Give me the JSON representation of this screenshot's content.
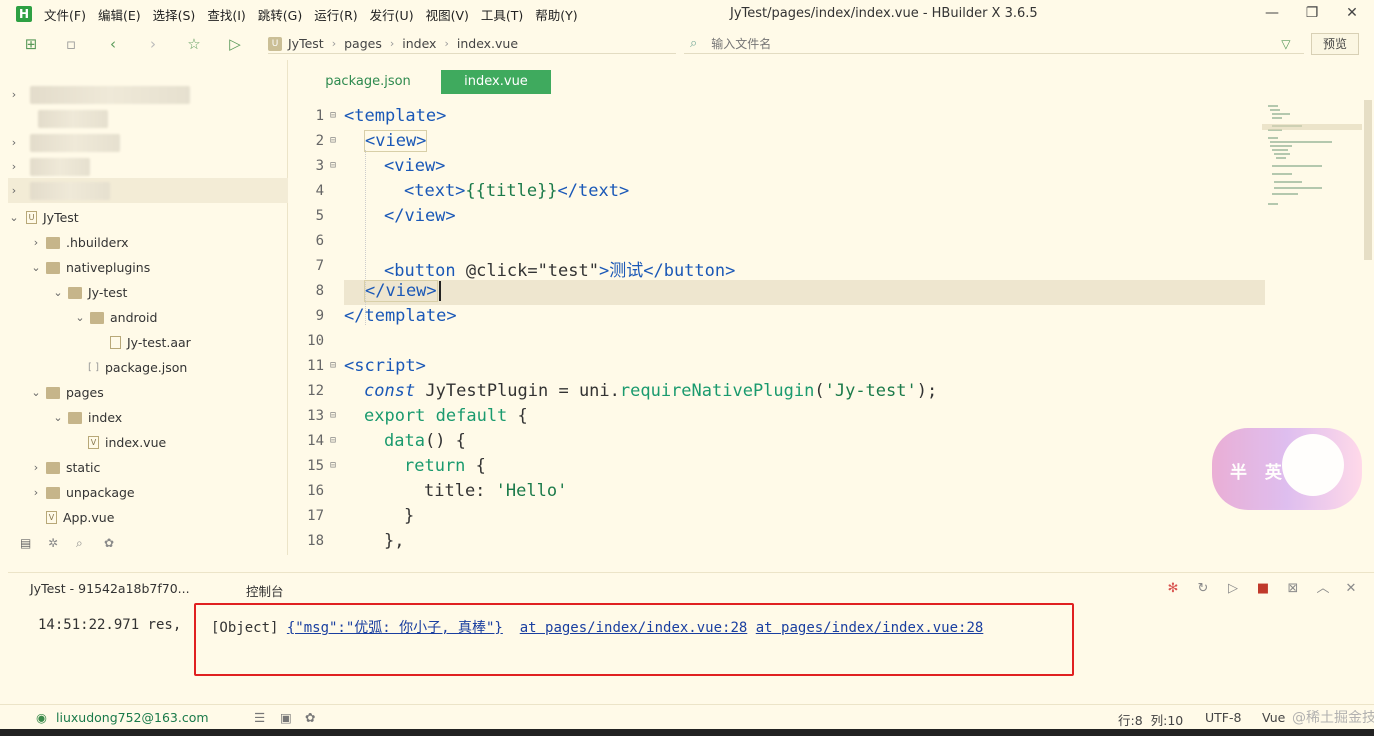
{
  "window": {
    "title": "JyTest/pages/index/index.vue - HBuilder X 3.6.5",
    "logo": "H",
    "menus": [
      "文件(F)",
      "编辑(E)",
      "选择(S)",
      "查找(I)",
      "跳转(G)",
      "运行(R)",
      "发行(U)",
      "视图(V)",
      "工具(T)",
      "帮助(Y)"
    ]
  },
  "toolbar": {
    "breadcrumb": [
      "JyTest",
      "pages",
      "index",
      "index.vue"
    ],
    "search_placeholder": "输入文件名",
    "preview_label": "预览"
  },
  "sidebar": {
    "project": "JyTest",
    "items": [
      {
        "label": ".hbuilderx",
        "kind": "folder"
      },
      {
        "label": "nativeplugins",
        "kind": "folder"
      },
      {
        "label": "Jy-test",
        "kind": "folder"
      },
      {
        "label": "android",
        "kind": "folder"
      },
      {
        "label": "Jy-test.aar",
        "kind": "file"
      },
      {
        "label": "package.json",
        "kind": "json"
      },
      {
        "label": "pages",
        "kind": "folder"
      },
      {
        "label": "index",
        "kind": "folder"
      },
      {
        "label": "index.vue",
        "kind": "vue"
      },
      {
        "label": "static",
        "kind": "folder"
      },
      {
        "label": "unpackage",
        "kind": "folder"
      },
      {
        "label": "App.vue",
        "kind": "vue"
      }
    ]
  },
  "editor": {
    "tabs": [
      "package.json",
      "index.vue"
    ],
    "active_tab": "index.vue",
    "line_numbers": [
      "1",
      "2",
      "3",
      "4",
      "5",
      "6",
      "7",
      "8",
      "9",
      "10",
      "11",
      "12",
      "13",
      "14",
      "15",
      "16",
      "17",
      "18"
    ],
    "code": {
      "l1": "<template>",
      "l2": "<view>",
      "l3": "<view>",
      "l4a": "<text>",
      "l4b": "{{title}}",
      "l4c": "</text>",
      "l5": "</view>",
      "l7a": "<button ",
      "l7b": "@click",
      "l7c": "=",
      "l7d": "\"test\"",
      "l7e": ">测试",
      "l7f": "</button>",
      "l8": "</view>",
      "l9": "</template>",
      "l11": "<script>",
      "l12a": "const ",
      "l12b": "JyTestPlugin = uni.",
      "l12c": "requireNativePlugin",
      "l12d": "(",
      "l12e": "'Jy-test'",
      "l12f": ");",
      "l13a": "export default ",
      "l13b": "{",
      "l14a": "data",
      "l14b": "() {",
      "l15a": "return ",
      "l15b": "{",
      "l16a": "title: ",
      "l16b": "'Hello'",
      "l17": "}",
      "l18": "},"
    }
  },
  "console": {
    "tab_device": "JyTest - 91542a18b7f70...",
    "tab_console": "控制台",
    "timestamp": "14:51:22.971 res,",
    "msg_prefix": "[Object] ",
    "msg_json": "{\"msg\":\"优弧: 你小子, 真棒\"}",
    "msg_loc1": "at pages/index/index.vue:28",
    "msg_loc2": "at pages/index/index.vue:28"
  },
  "statusbar": {
    "account": "liuxudong752@163.com",
    "position": "行:8  列:10",
    "encoding": "UTF-8",
    "lang": "Vue",
    "watermark": "@稀土掘金技术社区"
  },
  "sticker": {
    "text": "半 英"
  },
  "colors": {
    "background": "#fffae8",
    "accent_green": "#3faa5e",
    "highlight_red": "#e02020",
    "tag_blue": "#1a58b7"
  }
}
